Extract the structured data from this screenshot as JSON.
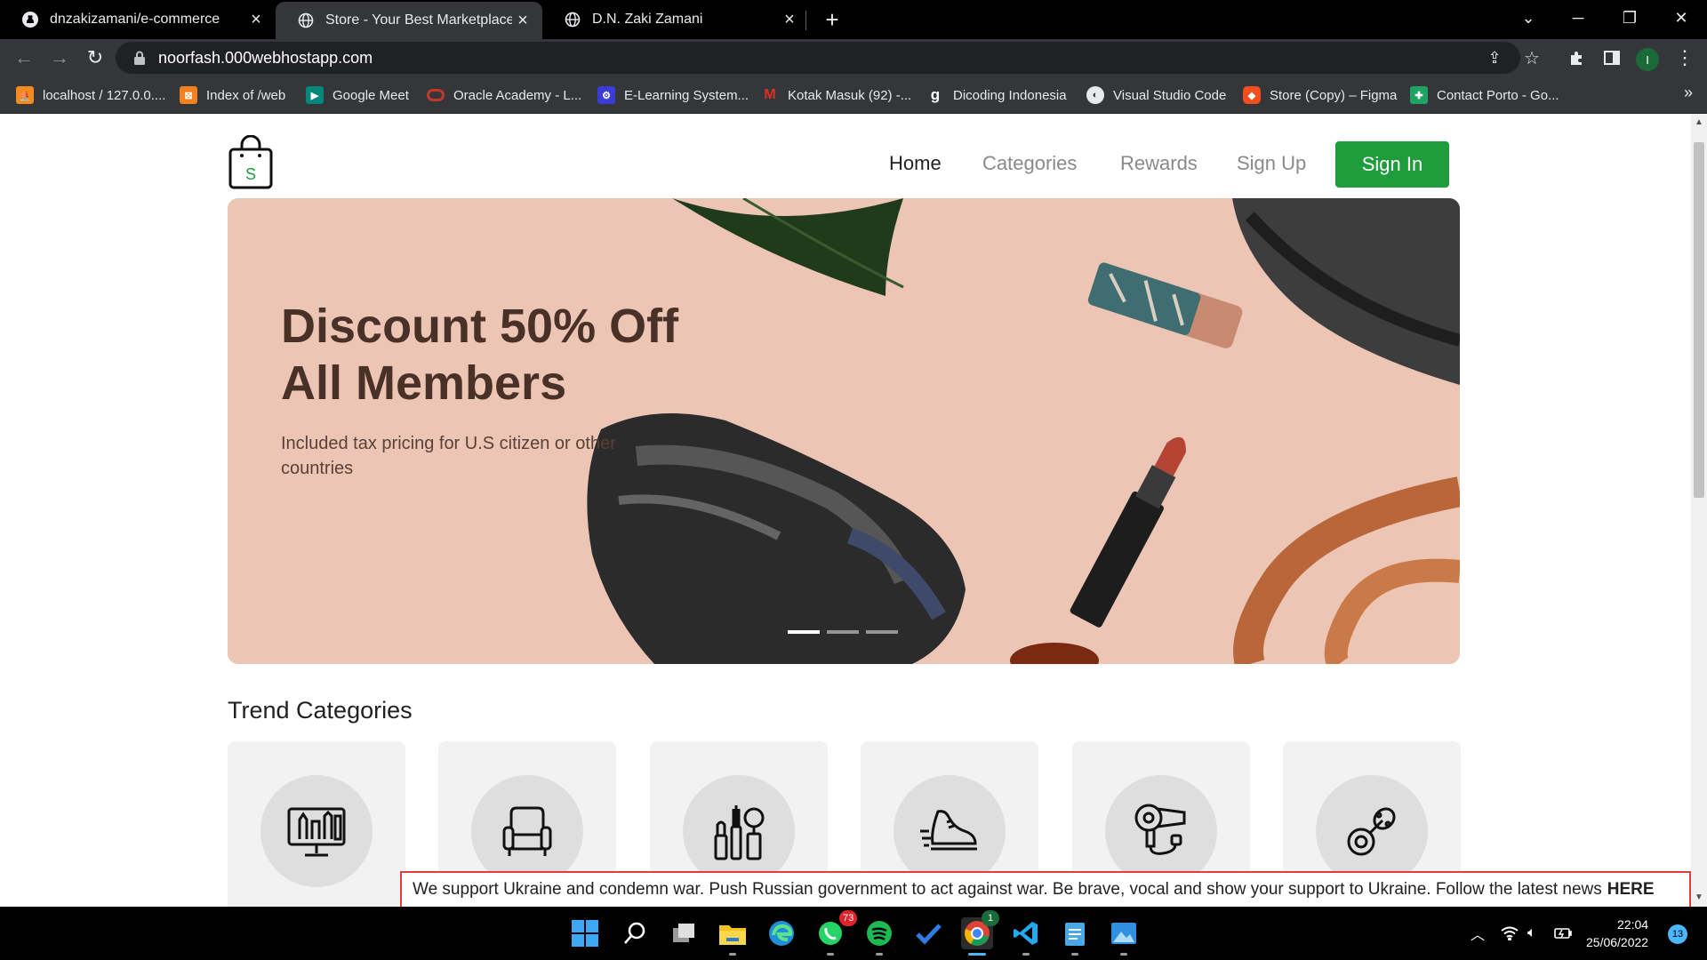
{
  "browser": {
    "tabs": [
      {
        "title": "dnzakizamani/e-commerce",
        "icon": "github-icon",
        "active": false
      },
      {
        "title": "Store - Your Best Marketplace",
        "icon": "globe-icon",
        "active": true
      },
      {
        "title": "D.N. Zaki Zamani",
        "icon": "globe-icon",
        "active": false
      }
    ],
    "address": "noorfash.000webhostapp.com",
    "profile_initial": "I",
    "bookmarks": [
      {
        "label": "localhost / 127.0.0....",
        "color": "#f58a1f"
      },
      {
        "label": "Index of /web",
        "color": "#f5801f"
      },
      {
        "label": "Google Meet",
        "color": "#00897b"
      },
      {
        "label": "Oracle Academy - L...",
        "color": "#c0392b"
      },
      {
        "label": "E-Learning System...",
        "color": "#3b3bd6"
      },
      {
        "label": "Kotak Masuk (92) -...",
        "color": "#d93025"
      },
      {
        "label": "Dicoding Indonesia",
        "color": "#5a5a5a"
      },
      {
        "label": "Visual Studio Code",
        "color": "#777777"
      },
      {
        "label": "Store (Copy) – Figma",
        "color": "#f24e1e"
      },
      {
        "label": "Contact Porto - Go...",
        "color": "#1ea362"
      }
    ]
  },
  "site": {
    "nav": {
      "home": "Home",
      "categories": "Categories",
      "rewards": "Rewards",
      "signup": "Sign Up",
      "signin": "Sign In"
    },
    "logo_letter": "S",
    "hero": {
      "title_line1": "Discount 50% Off",
      "title_line2": "All Members",
      "subtitle": "Included tax pricing for U.S citizen or other countries",
      "slide_count": 3,
      "active_slide": 1
    },
    "trend_title": "Trend Categories",
    "categories": [
      {
        "icon": "design-tools-icon"
      },
      {
        "icon": "armchair-icon"
      },
      {
        "icon": "makeup-icon"
      },
      {
        "icon": "sneaker-icon"
      },
      {
        "icon": "hair-dryer-icon"
      },
      {
        "icon": "pacifier-icon"
      }
    ],
    "banner": {
      "text": "We support Ukraine and condemn war. Push Russian government to act against war. Be brave, vocal and show your support to Ukraine. Follow the latest news",
      "link": "HERE"
    },
    "colors": {
      "accent": "#1f9d3c",
      "hero_bg": "#ecc5b4",
      "banner_border": "#e23c3c"
    }
  },
  "taskbar": {
    "whatsapp_badge": "73",
    "chrome_badge": "1",
    "time": "22:04",
    "date": "25/06/2022",
    "notifications": "13"
  }
}
